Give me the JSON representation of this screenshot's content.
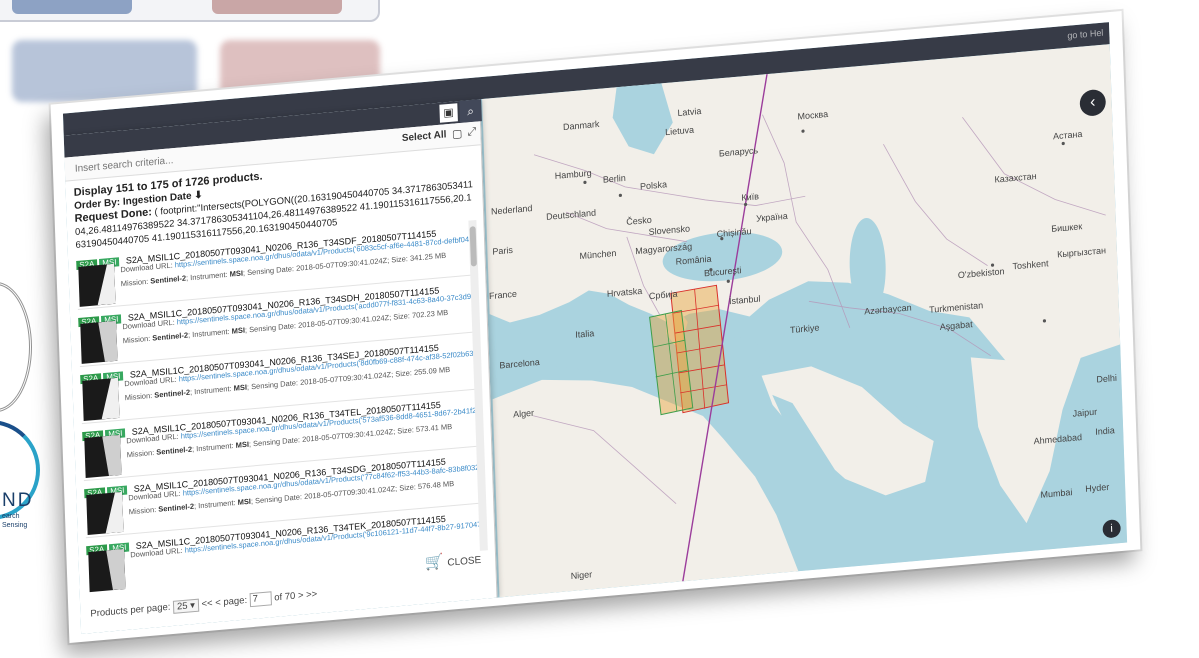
{
  "background": {
    "tile_left_label": "",
    "tile_right_label": "",
    "logo_letters": "ND",
    "logo_sub_line1": "earch",
    "logo_sub_line2": "Sensing"
  },
  "app": {
    "topbar_title": "",
    "topbar_corner": "go to Hel",
    "panel_title": ""
  },
  "search": {
    "placeholder": "Insert search criteria...",
    "select_all_label": "Select All"
  },
  "results": {
    "display_text": "Display 151 to 175 of 1726 products.",
    "order_by": "Order By: Ingestion Date",
    "request_label": "Request Done:",
    "request_text": "( footprint:\"Intersects(POLYGON((20.163190450440705 34.371786305341104,26.48114976389522 34.371786305341104,26.48114976389522 41.190115316117556,20.163190450440705 41.190115316117556,20.163190450440705"
  },
  "products": [
    {
      "tag1": "S2A",
      "tag2": "MSI",
      "name": "S2A_MSIL1C_20180507T093041_N0206_R136_T34SDF_20180507T114155",
      "url": "https://sentinels.space.noa.gr/dhus/odata/v1/Products('6083c5cf-af6e-4481-87cd-defbf04ed625')/$value",
      "mission": "Sentinel-2",
      "instrument": "MSI",
      "sensing_date": "2018-05-07T09:30:41.024Z",
      "size": "341.25 MB"
    },
    {
      "tag1": "S2A",
      "tag2": "MSI",
      "name": "S2A_MSIL1C_20180507T093041_N0206_R136_T34SDH_20180507T114155",
      "url": "https://sentinels.space.noa.gr/dhus/odata/v1/Products('acdd077f-f831-4c63-8a40-37c3d95e119')/$value",
      "mission": "Sentinel-2",
      "instrument": "MSI",
      "sensing_date": "2018-05-07T09:30:41.024Z",
      "size": "702.23 MB"
    },
    {
      "tag1": "S2A",
      "tag2": "MSI",
      "name": "S2A_MSIL1C_20180507T093041_N0206_R136_T34SEJ_20180507T114155",
      "url": "https://sentinels.space.noa.gr/dhus/odata/v1/Products('8d0fb69-c88f-474c-af38-52f02b6389c')/$value",
      "mission": "Sentinel-2",
      "instrument": "MSI",
      "sensing_date": "2018-05-07T09:30:41.024Z",
      "size": "255.09 MB"
    },
    {
      "tag1": "S2A",
      "tag2": "MSI",
      "name": "S2A_MSIL1C_20180507T093041_N0206_R136_T34TEL_20180507T114155",
      "url": "https://sentinels.space.noa.gr/dhus/odata/v1/Products('573af536-8dd8-4651-8d67-2b41f2fe84e')/$value",
      "mission": "Sentinel-2",
      "instrument": "MSI",
      "sensing_date": "2018-05-07T09:30:41.024Z",
      "size": "573.41 MB"
    },
    {
      "tag1": "S2A",
      "tag2": "MSI",
      "name": "S2A_MSIL1C_20180507T093041_N0206_R136_T34SDG_20180507T114155",
      "url": "https://sentinels.space.noa.gr/dhus/odata/v1/Products('77c84f62-ff53-44b3-8afc-83b8f0327581')/$value",
      "mission": "Sentinel-2",
      "instrument": "MSI",
      "sensing_date": "2018-05-07T09:30:41.024Z",
      "size": "576.48 MB"
    },
    {
      "tag1": "S2A",
      "tag2": "MSI",
      "name": "S2A_MSIL1C_20180507T093041_N0206_R136_T34TEK_20180507T114155",
      "url": "https://sentinels.space.noa.gr/dhus/odata/v1/Products('9c106121-11d7-44f7-8b27-9170472e75')/$value",
      "mission": "Sentinel-2",
      "instrument": "MSI",
      "sensing_date": "2018-05-07T09:30:41.024Z",
      "size": ""
    }
  ],
  "labels": {
    "download": "Download URL:",
    "mission": "Mission:",
    "instrument": "Instrument:",
    "sensing": "Sensing Date:",
    "size": "Size:"
  },
  "pager": {
    "per_page_label": "Products per page:",
    "per_page_value": "25",
    "first": "<<",
    "prev": "<",
    "page_label": "page:",
    "page_value": "7",
    "of_label": "of 70",
    "next": ">",
    "last": ">>",
    "close_label": "CLOSE"
  },
  "map_labels": {
    "latvia": "Latvia",
    "lietuva": "Lietuva",
    "danmark": "Danmark",
    "moskva": "Москва",
    "belarus": "Беларусь",
    "hamburg": "Hamburg",
    "berlin": "Berlin",
    "polska": "Polska",
    "nederland": "Nederland",
    "deutschland": "Deutschland",
    "ceskos": "Česko",
    "slovensko": "Slovensko",
    "kyiv": "Київ",
    "ukraine": "Україна",
    "kazakhstan": "Казахстан",
    "astana": "Астана",
    "paris": "Paris",
    "munchen": "München",
    "magyarorszag": "Magyarország",
    "chisinau": "Chișinău",
    "france": "France",
    "romania": "România",
    "bucuresti": "București",
    "hrvatska": "Hrvatska",
    "srbija": "Србија",
    "bishkek": "Бишкек",
    "kyrgyzstan": "Кыргызстан",
    "uzbekistan": "O'zbekiston",
    "toshkent": "Toshkent",
    "italia": "Italia",
    "istanbul": "İstanbul",
    "barcelona": "Barcelona",
    "turkiye": "Türkiye",
    "azerbaijan": "Azərbaycan",
    "turkmenistan": "Turkmenistan",
    "ashgabat": "Aşgabat",
    "alger": "Alger",
    "delhi": "Delhi",
    "jaipur": "Jaipur",
    "india": "India",
    "ahmedabad": "Ahmedabad",
    "mumbai": "Mumbai",
    "hyderabad": "Hyder",
    "niger": "Niger"
  },
  "colors": {
    "topbar": "#373b47",
    "sea": "#aad3df",
    "land": "#f2efe9",
    "footprint_red": "#d9302a",
    "footprint_green": "#3e9e4a",
    "footprint_fill": "#e8a33a",
    "orbit_line": "#9b3c9b"
  }
}
